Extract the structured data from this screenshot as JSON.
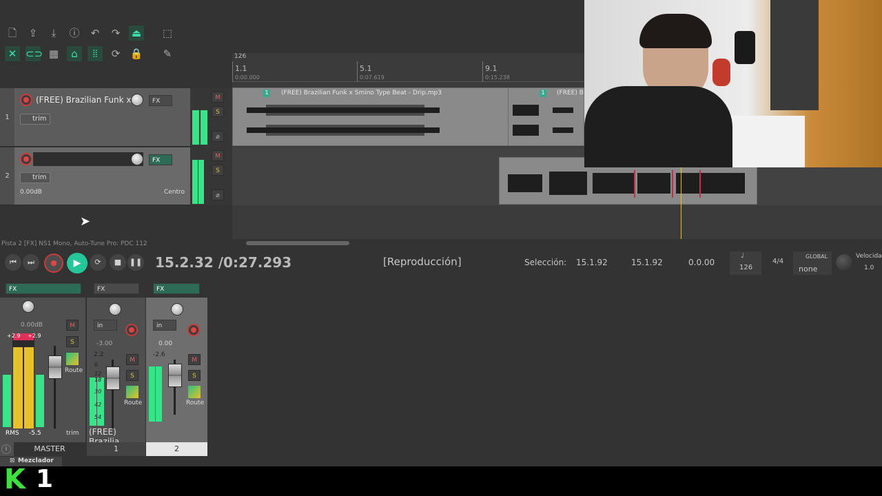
{
  "toolbar": {
    "icons": [
      "new-project-icon",
      "open-icon",
      "save-icon",
      "info-icon",
      "undo-icon",
      "redo-icon",
      "metronome-icon",
      "grid-icon",
      "ripple-icon",
      "link-icon",
      "snap-grid-icon",
      "auto-crossfade-icon",
      "envelope-icon",
      "loop-icon",
      "lock-icon",
      "marker-icon"
    ]
  },
  "tracks": [
    {
      "number": "1",
      "name": "(FREE) Brazilian Funk x S",
      "fx": "FX",
      "trim": "trim",
      "mute": "M",
      "solo": "S",
      "phase": "⌀"
    },
    {
      "number": "2",
      "name": "",
      "fx": "FX",
      "trim": "trim",
      "volume": "0.00dB",
      "pan": "Centro",
      "mute": "M",
      "solo": "S",
      "phase": "⌀"
    }
  ],
  "arrange": {
    "tempo_marker": "126",
    "ruler": [
      {
        "bar": "1.1",
        "time": "0:00.000"
      },
      {
        "bar": "5.1",
        "time": "0:07.619"
      },
      {
        "bar": "9.1",
        "time": "0:15.238"
      }
    ],
    "item1": {
      "label": "(FREE) Brazilian Funk x Smino Type Beat - Drip.mp3",
      "badge": "1"
    },
    "item2": {
      "label": "(FREE) Br",
      "badge": "1"
    },
    "colors": {
      "background": "#3b3b3b",
      "item": "#8a8a8a",
      "playhead": "#d6c24a"
    }
  },
  "status": {
    "info": "Pista 2 [FX] NS1 Mono, Auto-Tune Pro: PDC 112"
  },
  "transport": {
    "position": "15.2.32 /0:27.293",
    "state": "[Reproducción]",
    "selection_label": "Selección:",
    "selection_start": "15.1.92",
    "selection_end": "15.1.92",
    "selection_length": "0.0.00",
    "bpm": "126",
    "time_signature": "4/4",
    "global_label": "GLOBAL",
    "global_value": "none",
    "rate_label": "Velocidad",
    "rate_value": "1.0"
  },
  "mixer": {
    "master": {
      "fx": "FX",
      "volume": "0.00dB",
      "peak_l": "+2.9",
      "peak_r": "+2.9",
      "rms": "RMS",
      "rms_value": "-5.5",
      "route": "Route",
      "trim": "trim",
      "label": "MASTER",
      "mute": "M",
      "solo": "S"
    },
    "strip1": {
      "fx": "FX",
      "input": "in",
      "volume": "-3.00",
      "peak": "2.2",
      "route": "Route",
      "name": "(FREE) Brazilia",
      "number": "1",
      "mute": "M",
      "solo": "S"
    },
    "strip2": {
      "fx": "FX",
      "input": "in",
      "volume": "0.00",
      "peak": "-2.6",
      "route": "Route",
      "number": "2",
      "mute": "M",
      "solo": "S"
    },
    "scale": [
      "6",
      "12",
      "18",
      "30",
      "42",
      "54"
    ],
    "docker_tab": "Mezclador"
  },
  "logo": {
    "letter": "K",
    "digit": "1"
  }
}
